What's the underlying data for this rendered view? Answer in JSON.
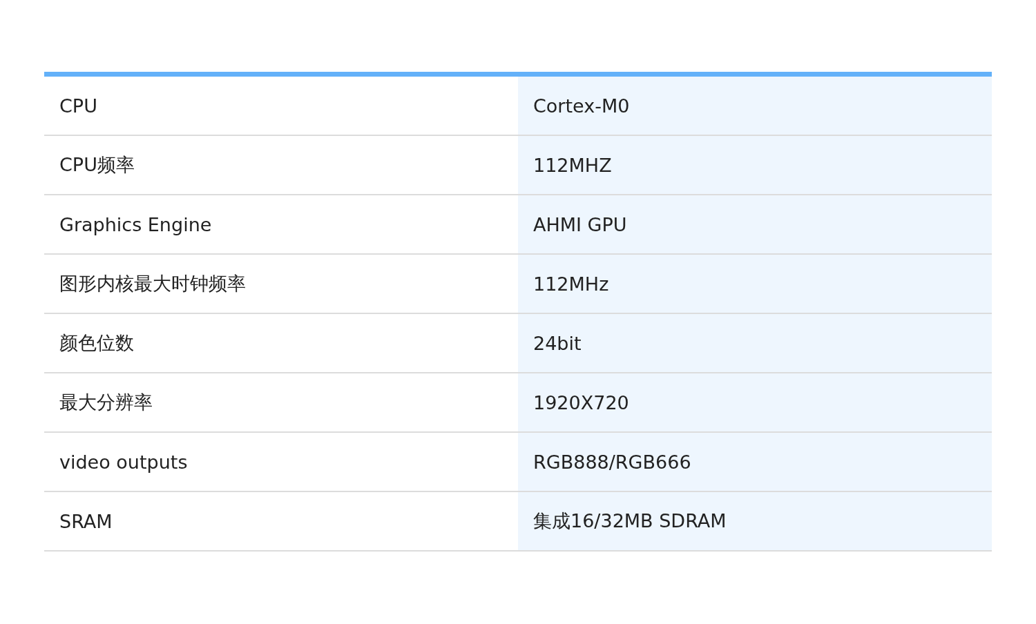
{
  "table": {
    "rows": [
      {
        "label": "CPU",
        "value": "Cortex-M0"
      },
      {
        "label": "CPU频率",
        "value": "112MHZ"
      },
      {
        "label": "Graphics Engine",
        "value": "AHMI GPU"
      },
      {
        "label": "图形内核最大时钟频率",
        "value": "112MHz"
      },
      {
        "label": "颜色位数",
        "value": "24bit"
      },
      {
        "label": "最大分辨率",
        "value": "1920X720"
      },
      {
        "label": "video outputs",
        "value": "RGB888/RGB666"
      },
      {
        "label": "SRAM",
        "value": "集成16/32MB SDRAM"
      }
    ]
  }
}
